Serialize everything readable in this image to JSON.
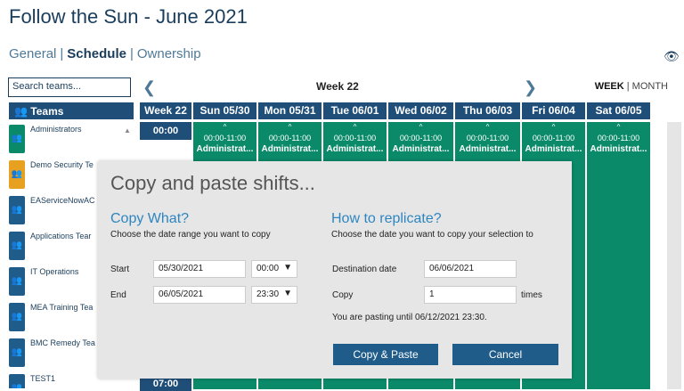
{
  "header": {
    "title": "Follow the Sun - June 2021"
  },
  "subnav": {
    "general": "General",
    "schedule": "Schedule",
    "ownership": "Ownership",
    "separator": "|"
  },
  "search": {
    "placeholder": "Search teams..."
  },
  "teams": {
    "header": "Teams",
    "items": [
      {
        "name": "Administrators",
        "color": "#0b8a6a"
      },
      {
        "name": "Demo Security Te",
        "color": "#e8a020"
      },
      {
        "name": "EAServiceNowAC",
        "color": "#1f5c8a"
      },
      {
        "name": "Applications Tear",
        "color": "#1f5c8a"
      },
      {
        "name": "IT Operations",
        "color": "#1f5c8a"
      },
      {
        "name": "MEA Training Tea",
        "color": "#1f5c8a"
      },
      {
        "name": "BMC Remedy Tea",
        "color": "#1f5c8a"
      },
      {
        "name": "TEST1",
        "color": "#1f5c8a"
      }
    ]
  },
  "calendar": {
    "week_label": "Week 22",
    "mode_week": "WEEK",
    "mode_sep": "|",
    "mode_month": "MONTH",
    "columns": [
      "Week 22",
      "Sun 05/30",
      "Mon 05/31",
      "Tue 06/01",
      "Wed 06/02",
      "Thu 06/03",
      "Fri 06/04",
      "Sat 06/05"
    ],
    "first_time": "00:00",
    "bottom_time": "07:00",
    "shift_time": "00:00-11:00",
    "shift_who": "Administrat..."
  },
  "dialog": {
    "title": "Copy and paste shifts...",
    "copy_what": {
      "heading": "Copy What?",
      "desc": "Choose the date range you want to copy",
      "start_label": "Start",
      "start_date": "05/30/2021",
      "start_time": "00:00",
      "end_label": "End",
      "end_date": "06/05/2021",
      "end_time": "23:30"
    },
    "replicate": {
      "heading": "How to replicate?",
      "desc": "Choose the date you want to copy your selection to",
      "dest_label": "Destination date",
      "dest_date": "06/06/2021",
      "copy_label": "Copy",
      "copy_count": "1",
      "times_label": "times",
      "note": "You are pasting until 06/12/2021 23:30."
    },
    "copy_paste_button": "Copy & Paste",
    "cancel_button": "Cancel"
  }
}
